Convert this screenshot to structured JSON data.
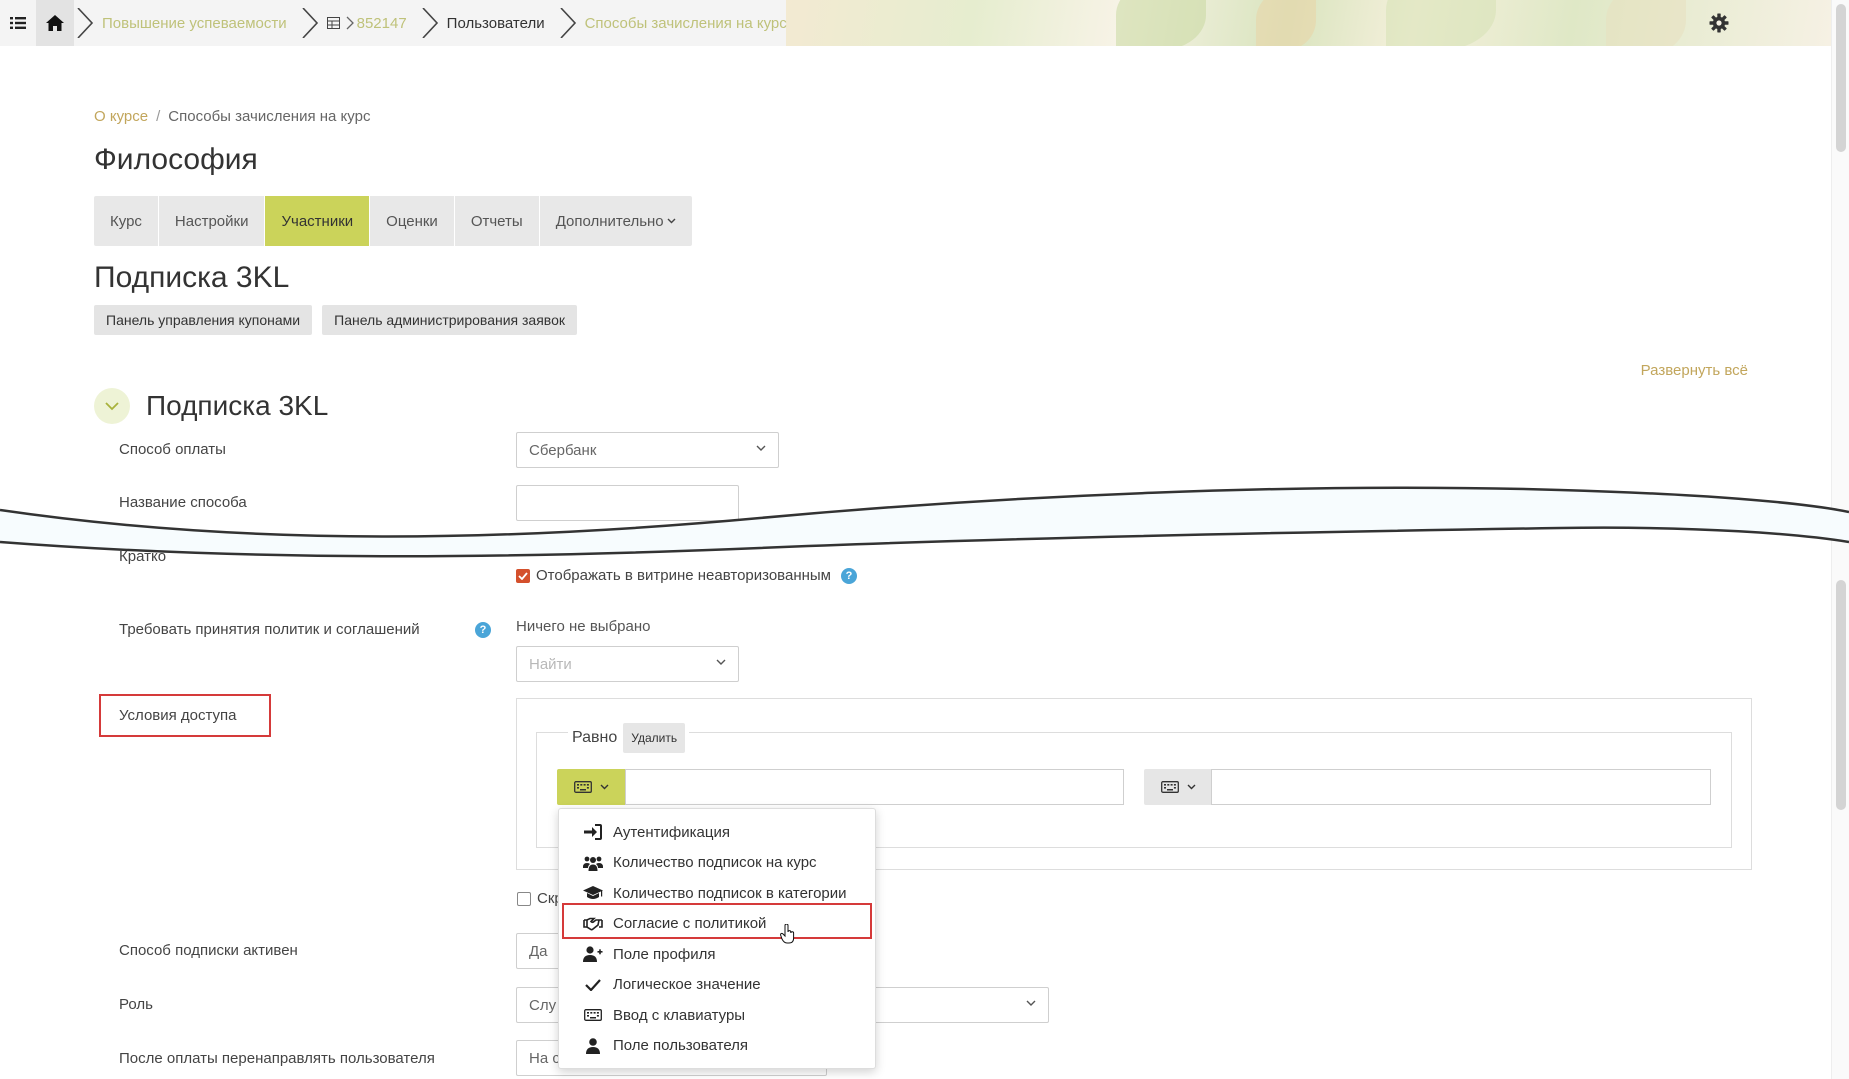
{
  "topbar": {
    "breadcrumbs": [
      {
        "label": "Повышение успеваемости"
      },
      {
        "label": "852147",
        "has_icon": true
      },
      {
        "label": "Пользователи"
      },
      {
        "label": "Способы зачисления на курс"
      }
    ]
  },
  "page_breadcrumb": {
    "link": "О курсе",
    "sep": "/",
    "current": "Способы зачисления на курс"
  },
  "course_title": "Философия",
  "tabs": [
    {
      "label": "Курс"
    },
    {
      "label": "Настройки"
    },
    {
      "label": "Участники",
      "active": true
    },
    {
      "label": "Оценки"
    },
    {
      "label": "Отчеты"
    },
    {
      "label": "Дополнительно"
    }
  ],
  "instance_title": "Подписка 3KL",
  "buttons": {
    "coupons": "Панель управления купонами",
    "requests": "Панель администрирования заявок"
  },
  "expand_all": "Развернуть всё",
  "section": {
    "title": "Подписка 3KL"
  },
  "form": {
    "payment_label": "Способ оплаты",
    "payment_value": "Сбербанк",
    "name_label": "Название способа",
    "short_label_partial": "Кратко",
    "showcase_checkbox": "Отображать в витрине неавторизованным",
    "policies_label": "Требовать принятия политик и соглашений",
    "policies_none": "Ничего не выбрано",
    "policies_search_placeholder": "Найти",
    "access_label": "Условия доступа",
    "equal_label": "Равно",
    "delete_label": "Удалить",
    "hide_partial": "Скр",
    "active_label": "Способ подписки активен",
    "active_value": "Да",
    "role_label": "Роль",
    "role_value": "Слу",
    "redirect_label": "После оплаты перенаправлять пользователя",
    "redirect_value": "На с"
  },
  "dropdown": {
    "items": [
      {
        "label": "Аутентификация",
        "icon": "sign-in-icon"
      },
      {
        "label": "Количество подписок на курс",
        "icon": "users-icon"
      },
      {
        "label": "Количество подписок в категории",
        "icon": "graduation-cap-icon"
      },
      {
        "label": "Согласие с политикой",
        "icon": "handshake-icon",
        "highlighted": true
      },
      {
        "label": "Поле профиля",
        "icon": "user-plus-icon"
      },
      {
        "label": "Логическое значение",
        "icon": "check-icon"
      },
      {
        "label": "Ввод с клавиатуры",
        "icon": "keyboard-icon"
      },
      {
        "label": "Поле пользователя",
        "icon": "user-icon"
      }
    ]
  },
  "colors": {
    "accent": "#cbd35a",
    "link": "#c2a65c",
    "highlight": "#d53a3a",
    "checkbox": "#d4502c",
    "help": "#4aa5d8"
  }
}
